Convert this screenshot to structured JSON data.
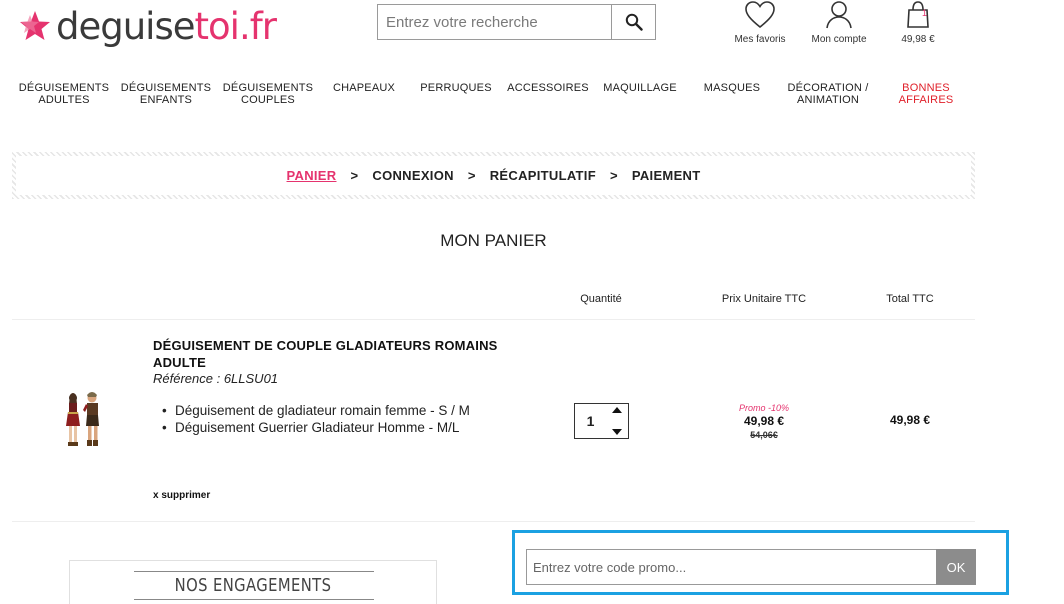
{
  "header": {
    "logo": {
      "part1": "deguise",
      "part2": "toi",
      "part3": ".fr"
    },
    "search": {
      "placeholder": "Entrez votre recherche"
    },
    "favorites_label": "Mes favoris",
    "account_label": "Mon compte",
    "cart_total": "49,98 €",
    "cart_count": "1"
  },
  "nav": [
    {
      "line1": "DÉGUISEMENTS",
      "line2": "ADULTES"
    },
    {
      "line1": "DÉGUISEMENTS",
      "line2": "ENFANTS"
    },
    {
      "line1": "DÉGUISEMENTS",
      "line2": "COUPLES"
    },
    {
      "line1": "CHAPEAUX",
      "line2": ""
    },
    {
      "line1": "PERRUQUES",
      "line2": ""
    },
    {
      "line1": "ACCESSOIRES",
      "line2": ""
    },
    {
      "line1": "MAQUILLAGE",
      "line2": ""
    },
    {
      "line1": "MASQUES",
      "line2": ""
    },
    {
      "line1": "DÉCORATION /",
      "line2": "ANIMATION"
    },
    {
      "line1": "BONNES",
      "line2": "AFFAIRES"
    }
  ],
  "steps": [
    "PANIER",
    "CONNEXION",
    "RÉCAPITULATIF",
    "PAIEMENT"
  ],
  "step_separator": ">",
  "cart_title": "MON PANIER",
  "columns": {
    "quantity": "Quantité",
    "unit_price": "Prix Unitaire TTC",
    "total": "Total TTC"
  },
  "product": {
    "title": "DÉGUISEMENT DE COUPLE GLADIATEURS ROMAINS ADULTE",
    "reference": "Référence : 6LLSU01",
    "items": [
      "Déguisement de gladiateur romain femme - S / M",
      "Déguisement Guerrier Gladiateur Homme - M/L"
    ],
    "quantity": "1",
    "promo_label": "Promo -10%",
    "unit_price": "49,98 €",
    "old_price": "54,06€",
    "total": "49,98 €",
    "remove_label": "x supprimer"
  },
  "promo": {
    "placeholder": "Entrez votre code promo...",
    "button": "OK"
  },
  "engagements_title": "NOS ENGAGEMENTS",
  "colors": {
    "accent": "#e5336e",
    "promo_border": "#1ba1e2",
    "ok_button": "#8c8c8c",
    "sale_nav": "#e0202a"
  }
}
